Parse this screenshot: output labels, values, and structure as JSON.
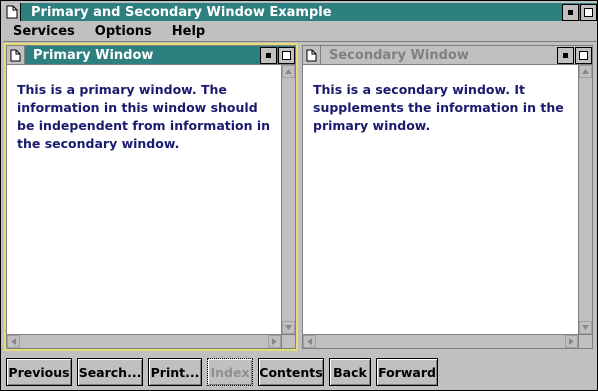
{
  "window": {
    "title": "Primary and Secondary Window Example"
  },
  "menubar": {
    "items": [
      "Services",
      "Options",
      "Help"
    ]
  },
  "primary": {
    "title": "Primary Window",
    "text": "This is a primary window.  The information in this window should be independent from information in the secondary window."
  },
  "secondary": {
    "title": "Secondary Window",
    "text": "This is a secondary window.  It supplements the information in the primary window."
  },
  "buttons": {
    "previous": "Previous",
    "search": "Search...",
    "print": "Print...",
    "index": "Index",
    "contents": "Contents",
    "back": "Back",
    "forward": "Forward"
  },
  "colors": {
    "title_active": "#2e7f80",
    "body_text": "#1a1a6e",
    "primary_border": "#e6dd78"
  },
  "icons": {
    "system_menu": "page-icon",
    "minimize": "minimize-icon",
    "maximize": "maximize-icon"
  }
}
